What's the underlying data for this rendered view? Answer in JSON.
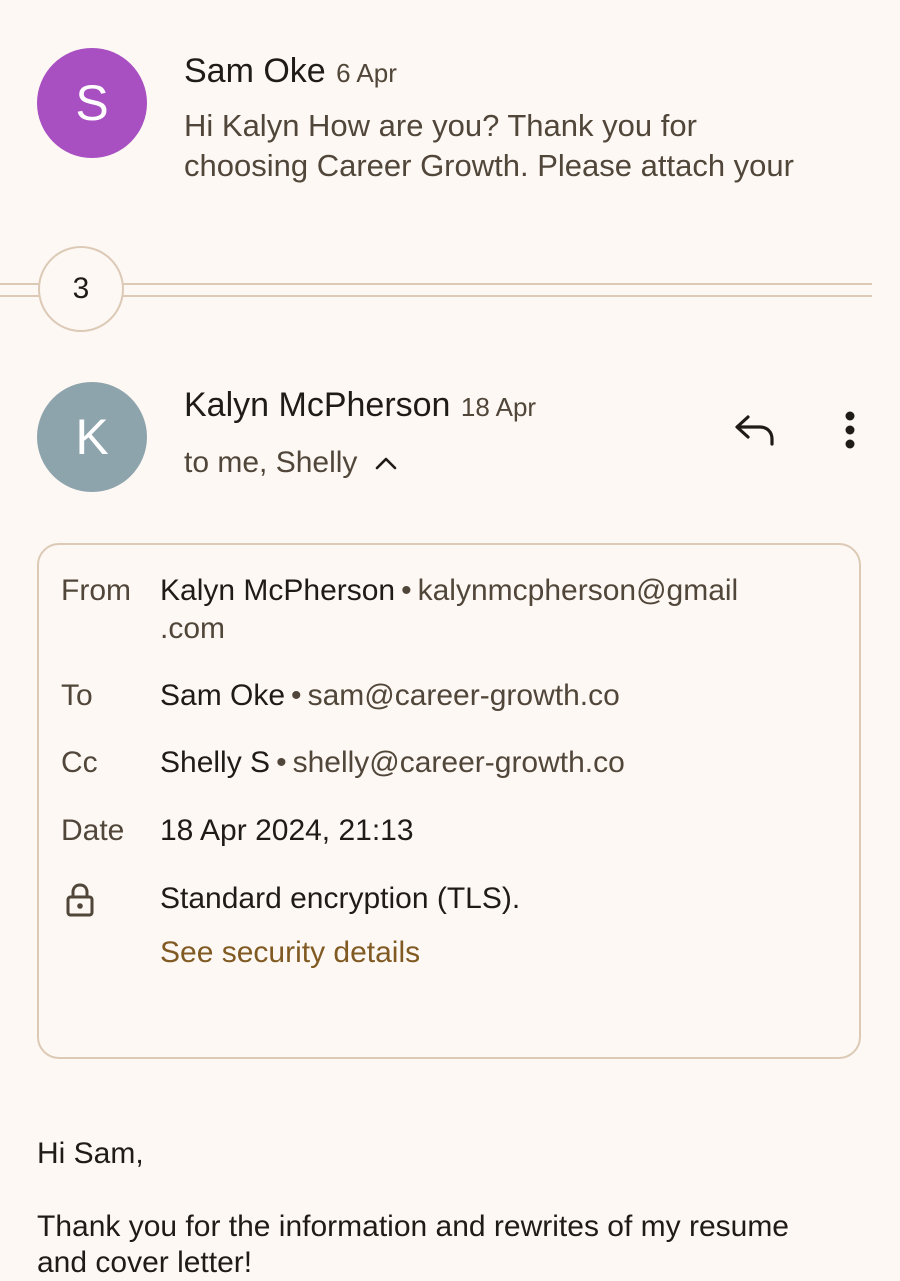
{
  "collapsed_message": {
    "avatar_letter": "S",
    "sender": "Sam Oke",
    "date": "6 Apr",
    "snippet_line1": "Hi Kalyn How are you? Thank you for",
    "snippet_line2": "choosing Career Growth. Please attach your"
  },
  "collapsed_count": "3",
  "expanded_message": {
    "avatar_letter": "K",
    "sender": "Kalyn McPherson",
    "date": "18 Apr",
    "recipients": "to me, Shelly",
    "icons": {
      "reply": "reply-icon",
      "more": "more-vert-icon",
      "toggle": "chevron-up-icon"
    }
  },
  "details": {
    "from_label": "From",
    "from_name": "Kalyn McPherson",
    "from_email_line1": "kalynmcpherson@gmail",
    "from_email_line2": ".com",
    "to_label": "To",
    "to_name": "Sam Oke",
    "to_email": "sam@career-growth.co",
    "cc_label": "Cc",
    "cc_name": "Shelly S",
    "cc_email": "shelly@career-growth.co",
    "date_label": "Date",
    "date_value": "18 Apr 2024, 21:13",
    "encryption_icon": "lock-icon",
    "encryption_text": "Standard encryption (TLS).",
    "security_link": "See security details",
    "separator": "•"
  },
  "body": {
    "greeting": "Hi Sam,",
    "line1": "Thank you for the information and rewrites of my resume",
    "line2": "and cover letter!"
  },
  "colors": {
    "background": "#fdf8f3",
    "avatar_s": "#a84fc2",
    "avatar_k": "#8ea4ad",
    "link": "#805a22",
    "border": "#dcc9b6"
  }
}
